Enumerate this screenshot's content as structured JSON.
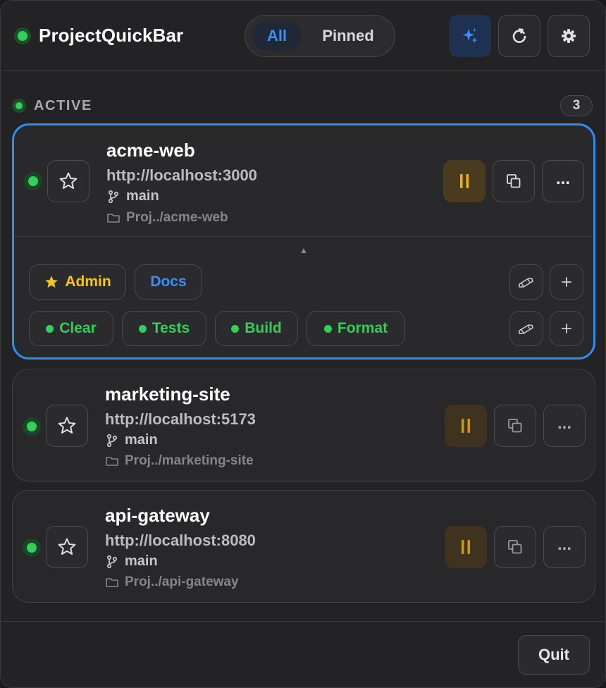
{
  "app": {
    "title": "ProjectQuickBar"
  },
  "filter": {
    "all_label": "All",
    "pinned_label": "Pinned"
  },
  "section": {
    "title": "ACTIVE",
    "count": "3"
  },
  "projects": [
    {
      "name": "acme-web",
      "url": "http://localhost:3000",
      "branch": "main",
      "path": "Proj../acme-web"
    },
    {
      "name": "marketing-site",
      "url": "http://localhost:5173",
      "branch": "main",
      "path": "Proj../marketing-site"
    },
    {
      "name": "api-gateway",
      "url": "http://localhost:8080",
      "branch": "main",
      "path": "Proj../api-gateway"
    }
  ],
  "links": [
    {
      "label": "Admin",
      "starred": true
    },
    {
      "label": "Docs",
      "starred": false
    }
  ],
  "commands": [
    {
      "label": "Clear"
    },
    {
      "label": "Tests"
    },
    {
      "label": "Build"
    },
    {
      "label": "Format"
    }
  ],
  "more_label": "...",
  "footer": {
    "quit_label": "Quit"
  },
  "colors": {
    "accent": "#2e8bf0",
    "running": "#2fd158",
    "pause": "#e5b21a",
    "star": "#f5c518"
  },
  "icons": [
    "sparkle-icon",
    "refresh-icon",
    "gear-icon",
    "star-icon",
    "pause-icon",
    "copy-icon",
    "branch-icon",
    "folder-icon",
    "pencil-icon",
    "plus-icon"
  ]
}
